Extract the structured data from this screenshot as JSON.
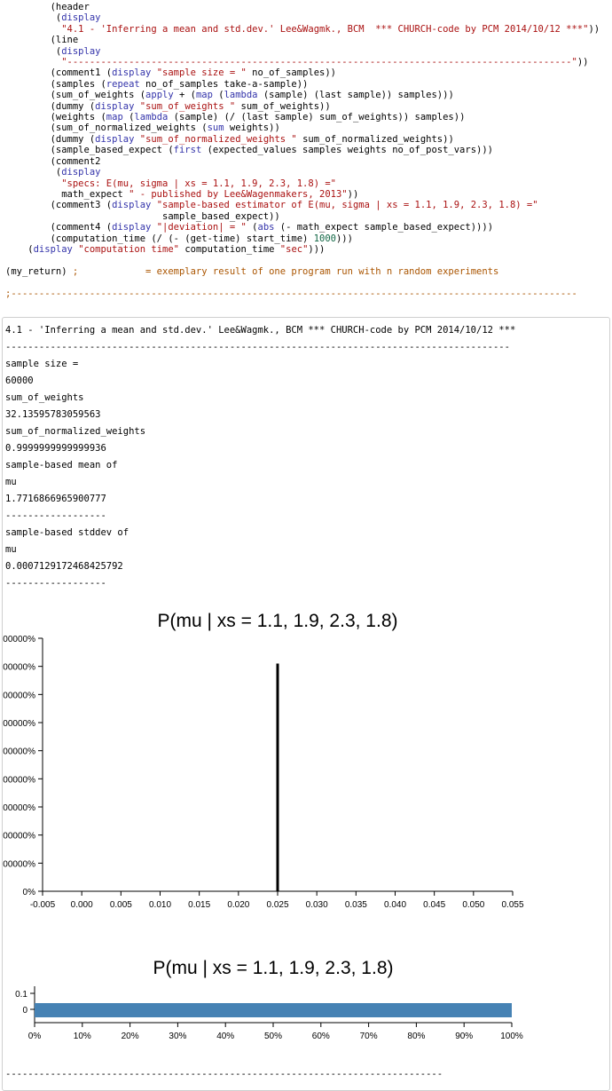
{
  "code": {
    "lines": [
      [
        {
          "t": "        (header"
        }
      ],
      [
        {
          "t": "         (",
          "c": ""
        },
        {
          "t": "display",
          "c": "kw"
        }
      ],
      [
        {
          "t": "          ",
          "c": ""
        },
        {
          "t": "\"4.1 - 'Inferring a mean and std.dev.' Lee&Wagmk., BCM  *** CHURCH-code by PCM 2014/10/12 ***\"",
          "c": "str"
        },
        {
          "t": "))"
        }
      ],
      [
        {
          "t": "        (line"
        }
      ],
      [
        {
          "t": "         (",
          "c": ""
        },
        {
          "t": "display",
          "c": "kw"
        }
      ],
      [
        {
          "t": "          ",
          "c": ""
        },
        {
          "t": "\"------------------------------------------------------------------------------------------\"",
          "c": "str"
        },
        {
          "t": "))"
        }
      ],
      [
        {
          "t": "        (comment1 (",
          "c": ""
        },
        {
          "t": "display",
          "c": "kw"
        },
        {
          "t": " "
        },
        {
          "t": "\"sample size = \"",
          "c": "str"
        },
        {
          "t": " no_of_samples))"
        }
      ],
      [
        {
          "t": "        (samples (",
          "c": ""
        },
        {
          "t": "repeat",
          "c": "kw"
        },
        {
          "t": " no_of_samples take-a-sample))"
        }
      ],
      [
        {
          "t": "        (sum_of_weights (",
          "c": ""
        },
        {
          "t": "apply",
          "c": "kw"
        },
        {
          "t": " + ("
        },
        {
          "t": "map",
          "c": "kw"
        },
        {
          "t": " ("
        },
        {
          "t": "lambda",
          "c": "kw"
        },
        {
          "t": " (sample) (last sample)) samples)))"
        }
      ],
      [
        {
          "t": "        (dummy (",
          "c": ""
        },
        {
          "t": "display",
          "c": "kw"
        },
        {
          "t": " "
        },
        {
          "t": "\"sum_of_weights \"",
          "c": "str"
        },
        {
          "t": " sum_of_weights))"
        }
      ],
      [
        {
          "t": "        (weights (",
          "c": ""
        },
        {
          "t": "map",
          "c": "kw"
        },
        {
          "t": " ("
        },
        {
          "t": "lambda",
          "c": "kw"
        },
        {
          "t": " (sample) (/ (last sample) sum_of_weights)) samples))"
        }
      ],
      [
        {
          "t": "        (sum_of_normalized_weights (",
          "c": ""
        },
        {
          "t": "sum",
          "c": "kw"
        },
        {
          "t": " weights))"
        }
      ],
      [
        {
          "t": "        (dummy (",
          "c": ""
        },
        {
          "t": "display",
          "c": "kw"
        },
        {
          "t": " "
        },
        {
          "t": "\"sum_of_normalized_weights \"",
          "c": "str"
        },
        {
          "t": " sum_of_normalized_weights))"
        }
      ],
      [
        {
          "t": "        (sample_based_expect (",
          "c": ""
        },
        {
          "t": "first",
          "c": "kw"
        },
        {
          "t": " (expected_values samples weights no_of_post_vars)))"
        }
      ],
      [
        {
          "t": "        (comment2"
        }
      ],
      [
        {
          "t": "         (",
          "c": ""
        },
        {
          "t": "display",
          "c": "kw"
        }
      ],
      [
        {
          "t": "          ",
          "c": ""
        },
        {
          "t": "\"specs: E(mu, sigma | xs = 1.1, 1.9, 2.3, 1.8) =\"",
          "c": "str"
        }
      ],
      [
        {
          "t": "          math_expect "
        },
        {
          "t": "\" - published by Lee&Wagenmakers, 2013\"",
          "c": "str"
        },
        {
          "t": "))"
        }
      ],
      [
        {
          "t": "        (comment3 (",
          "c": ""
        },
        {
          "t": "display",
          "c": "kw"
        },
        {
          "t": " "
        },
        {
          "t": "\"sample-based estimator of E(mu, sigma | xs = 1.1, 1.9, 2.3, 1.8) =\"",
          "c": "str"
        }
      ],
      [
        {
          "t": "                            sample_based_expect))"
        }
      ],
      [
        {
          "t": "        (comment4 (",
          "c": ""
        },
        {
          "t": "display",
          "c": "kw"
        },
        {
          "t": " "
        },
        {
          "t": "\"|deviation| = \"",
          "c": "str"
        },
        {
          "t": " ("
        },
        {
          "t": "abs",
          "c": "kw"
        },
        {
          "t": " (- math_expect sample_based_expect))))"
        }
      ],
      [
        {
          "t": "        (computation_time (/ (- (get-time) start_time) "
        },
        {
          "t": "1000",
          "c": "num"
        },
        {
          "t": ")))"
        }
      ],
      [
        {
          "t": "    (",
          "c": ""
        },
        {
          "t": "display",
          "c": "kw"
        },
        {
          "t": " "
        },
        {
          "t": "\"computation time\"",
          "c": "str"
        },
        {
          "t": " computation_time "
        },
        {
          "t": "\"sec\"",
          "c": "str"
        },
        {
          "t": ")))"
        }
      ],
      [
        {
          "t": ""
        }
      ],
      [
        {
          "t": "(my_return) "
        },
        {
          "t": ";            = exemplary result of one program run with n random experiments",
          "c": "cmt"
        }
      ],
      [
        {
          "t": ""
        }
      ],
      [
        {
          "t": ";-----------------------------------------------------------------------------------------------------",
          "c": "line-sep"
        }
      ]
    ]
  },
  "output": {
    "lines": [
      "4.1 - 'Inferring a mean and std.dev.' Lee&Wagmk., BCM *** CHURCH-code by PCM 2014/10/12 ***",
      "------------------------------------------------------------------------------------------",
      "sample size =",
      "60000",
      "sum_of_weights",
      "32.13595783059563",
      "sum_of_normalized_weights",
      "0.9999999999999936",
      "sample-based mean of",
      "mu",
      "1.7716866965900777",
      "------------------",
      "sample-based stddev of",
      "mu",
      "0.0007129172468425792",
      "------------------"
    ],
    "footer_line": "------------------------------------------------------------------------------"
  },
  "chart_data": [
    {
      "type": "bar",
      "title": "P(mu | xs = 1.1, 1.9, 2.3, 1.8)",
      "xlabel": "",
      "ylabel": "",
      "x_ticks": [
        "-0.005",
        "0.000",
        "0.005",
        "0.010",
        "0.015",
        "0.020",
        "0.025",
        "0.030",
        "0.035",
        "0.040",
        "0.045",
        "0.050",
        "0.055"
      ],
      "xlim": [
        -0.005,
        0.055
      ],
      "y_ticks": [
        "0%",
        "00000%",
        "00000%",
        "00000%",
        "00000%",
        "00000%",
        "00000%",
        "00000%",
        "00000%",
        "00000%"
      ],
      "ylim": [
        0,
        1
      ],
      "series": [
        {
          "x": [
            0.025
          ],
          "values": [
            0.9
          ]
        }
      ],
      "grid": false
    },
    {
      "type": "bar",
      "orientation": "horizontal",
      "title": "P(mu | xs = 1.1, 1.9, 2.3, 1.8)",
      "xlabel": "",
      "ylabel": "",
      "x_ticks": [
        "0%",
        "10%",
        "20%",
        "30%",
        "40%",
        "50%",
        "60%",
        "70%",
        "80%",
        "90%",
        "100%"
      ],
      "xlim": [
        0,
        1
      ],
      "y_ticks": [
        "0.1",
        "0"
      ],
      "series": [
        {
          "values": [
            1.0
          ]
        }
      ],
      "bar_color": "#4682b4",
      "grid": false
    }
  ]
}
